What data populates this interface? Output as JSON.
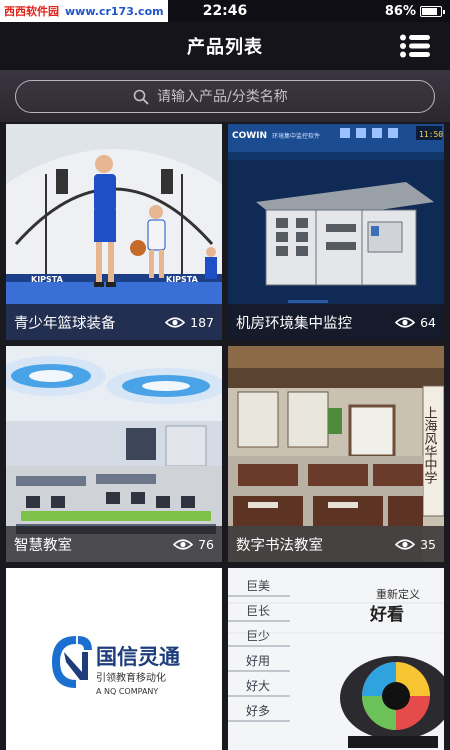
{
  "status_bar": {
    "watermark_left": "西西软件园",
    "watermark_right": "www.cr173.com",
    "time": "22:46",
    "battery": "86%",
    "battery_level": 0.86
  },
  "header": {
    "title": "产品列表",
    "menu_icon": "list-menu-icon"
  },
  "search": {
    "placeholder": "请输入产品/分类名称",
    "icon": "search-icon"
  },
  "products": [
    {
      "name": "青少年篮球装备",
      "views": "187"
    },
    {
      "name": "机房环境集中监控",
      "views": "64"
    },
    {
      "name": "智慧教室",
      "views": "76"
    },
    {
      "name": "数字书法教室",
      "views": "35"
    },
    {
      "name": "",
      "views": ""
    },
    {
      "name": "",
      "views": ""
    }
  ],
  "image_text": {
    "kipsta": "KIPSTA",
    "cowin_logo": "COWIN",
    "cowin_title": "环境集中监控软件",
    "cowin_clock": "11:50",
    "vertical_banner": "上海风华中学",
    "gx_company": "国信灵通",
    "gx_slogan": "引领教育移动化",
    "gx_english": "A NQ COMPANY",
    "ad_heading": "重新定义",
    "ad_main": "好看",
    "ad_list": [
      "巨美",
      "巨长",
      "巨少",
      "好用",
      "好大",
      "好多"
    ]
  },
  "colors": {
    "background": "#1b1920",
    "header": "#16141b",
    "search_bg": "#2f2b34",
    "caption_bg": "#19161c",
    "text": "#ffffff"
  }
}
